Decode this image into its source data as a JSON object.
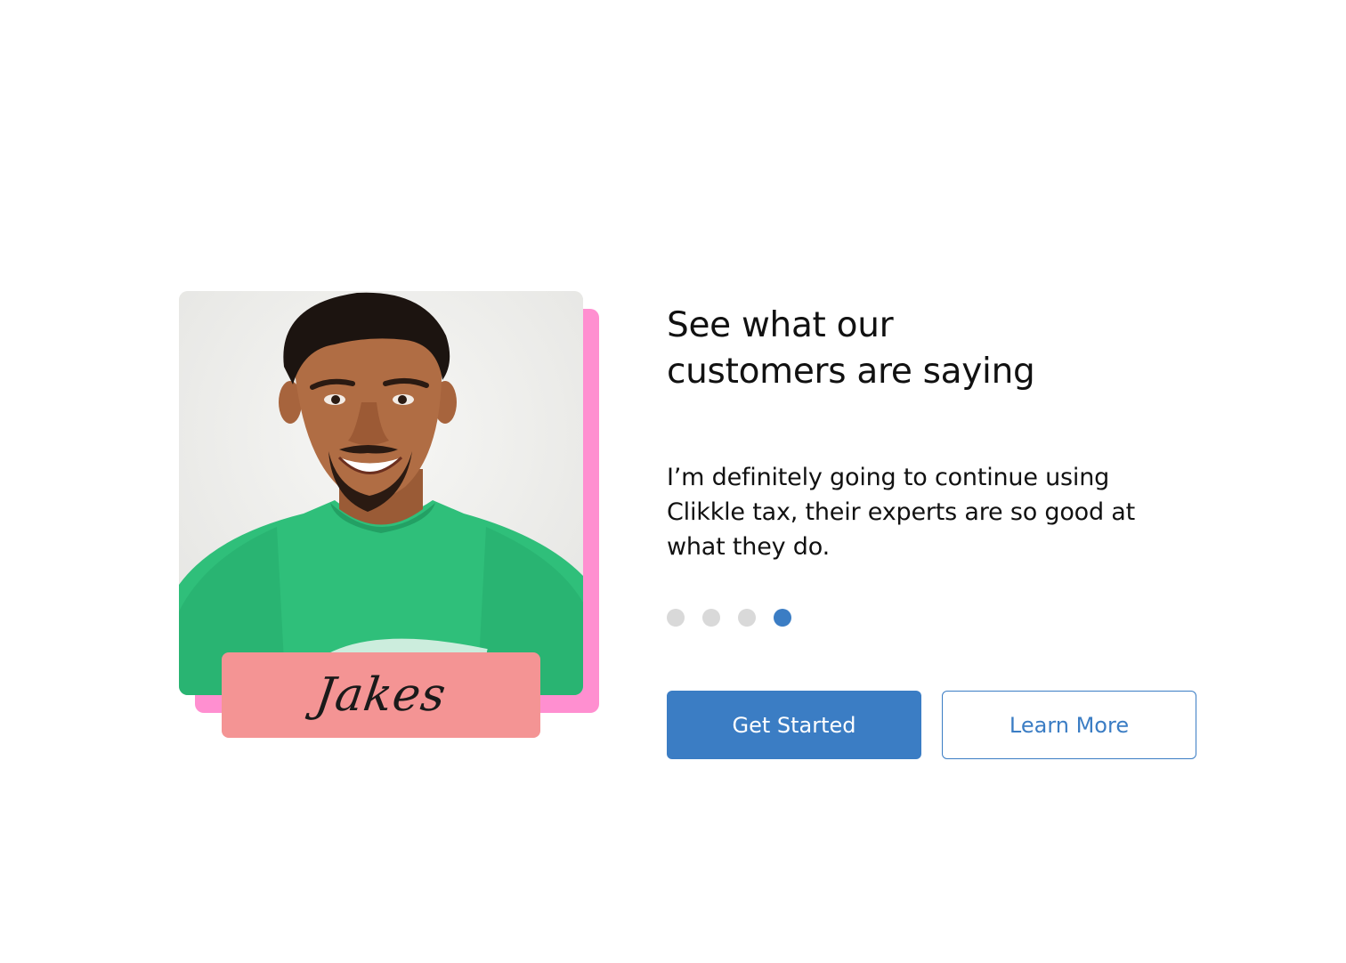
{
  "testimonial": {
    "heading_line1": "See what our",
    "heading_line2": "customers are saying",
    "quote": "I’m definitely going to continue using Clikkle tax, their experts are so good at what they do.",
    "customer_name": "Jakes",
    "photo_icon": "customer-portrait"
  },
  "carousel": {
    "dots": [
      {
        "label": "slide 1",
        "active": false
      },
      {
        "label": "slide 2",
        "active": false
      },
      {
        "label": "slide 3",
        "active": false
      },
      {
        "label": "slide 4",
        "active": true
      }
    ],
    "active_color": "#3b7dc4",
    "inactive_color": "#d9d9d9"
  },
  "actions": {
    "primary_label": "Get Started",
    "secondary_label": "Learn More"
  },
  "colors": {
    "accent": "#3b7dc4",
    "photo_accent": "#ff8fd0",
    "name_tag": "#f49494"
  }
}
